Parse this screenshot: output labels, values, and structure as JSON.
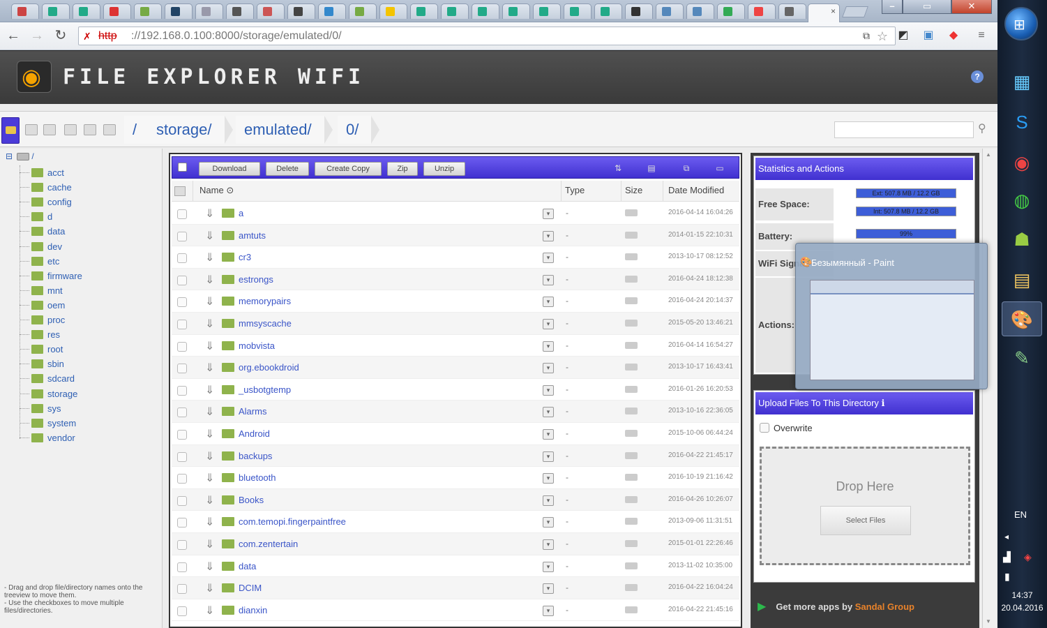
{
  "browser": {
    "url_scheme": "http",
    "url_rest": "://192.168.0.100:8000/storage/emulated/0/",
    "tab_close": "×"
  },
  "app": {
    "title": "FILE EXPLORER WIFI",
    "help": "?"
  },
  "breadcrumbs": [
    "/",
    "storage/",
    "emulated/",
    "0/"
  ],
  "tree": {
    "root": "/",
    "items": [
      "acct",
      "cache",
      "config",
      "d",
      "data",
      "dev",
      "etc",
      "firmware",
      "mnt",
      "oem",
      "proc",
      "res",
      "root",
      "sbin",
      "sdcard",
      "storage",
      "sys",
      "system",
      "vendor"
    ],
    "hint": "- Drag and drop file/directory names onto the treeview to move them.\n- Use the checkboxes to move multiple files/directories."
  },
  "toolbar": {
    "download": "Download",
    "delete": "Delete",
    "create_copy": "Create Copy",
    "zip": "Zip",
    "unzip": "Unzip"
  },
  "columns": {
    "name": "Name",
    "type": "Type",
    "size": "Size",
    "date": "Date Modified"
  },
  "files": [
    {
      "name": "a",
      "type": "-",
      "date": "2016-04-14 16:04:26"
    },
    {
      "name": "amtuts",
      "type": "-",
      "date": "2014-01-15 22:10:31"
    },
    {
      "name": "cr3",
      "type": "-",
      "date": "2013-10-17 08:12:52"
    },
    {
      "name": "estrongs",
      "type": "-",
      "date": "2016-04-24 18:12:38"
    },
    {
      "name": "memorypairs",
      "type": "-",
      "date": "2016-04-24 20:14:37"
    },
    {
      "name": "mmsyscache",
      "type": "-",
      "date": "2015-05-20 13:46:21"
    },
    {
      "name": "mobvista",
      "type": "-",
      "date": "2016-04-14 16:54:27"
    },
    {
      "name": "org.ebookdroid",
      "type": "-",
      "date": "2013-10-17 16:43:41"
    },
    {
      "name": "_usbotgtemp",
      "type": "-",
      "date": "2016-01-26 16:20:53"
    },
    {
      "name": "Alarms",
      "type": "-",
      "date": "2013-10-16 22:36:05"
    },
    {
      "name": "Android",
      "type": "-",
      "date": "2015-10-06 06:44:24"
    },
    {
      "name": "backups",
      "type": "-",
      "date": "2016-04-22 21:45:17"
    },
    {
      "name": "bluetooth",
      "type": "-",
      "date": "2016-10-19 21:16:42"
    },
    {
      "name": "Books",
      "type": "-",
      "date": "2016-04-26 10:26:07"
    },
    {
      "name": "com.temopi.fingerpaintfree",
      "type": "-",
      "date": "2013-09-06 11:31:51"
    },
    {
      "name": "com.zentertain",
      "type": "-",
      "date": "2015-01-01 22:26:46"
    },
    {
      "name": "data",
      "type": "-",
      "date": "2013-11-02 10:35:00"
    },
    {
      "name": "DCIM",
      "type": "-",
      "date": "2016-04-22 16:04:24"
    },
    {
      "name": "dianxin",
      "type": "-",
      "date": "2016-04-22 21:45:16"
    }
  ],
  "stats": {
    "header": "Statistics and Actions",
    "free_space_label": "Free Space:",
    "ext_space": "Ext: 507.8 MB / 12.2 GB",
    "int_space": "Int: 507.8 MB / 12.2 GB",
    "battery_label": "Battery:",
    "battery_value": "99%",
    "wifi_label": "WiFi Signal:",
    "actions_label": "Actions:"
  },
  "upload": {
    "header": "Upload Files To This Directory",
    "overwrite": "Overwrite",
    "drop_here": "Drop Here",
    "select_files": "Select Files"
  },
  "footer": {
    "more_apps": "Get more apps by",
    "brand": "Sandal Group"
  },
  "thumbnail": {
    "title": "Безымянный - Paint"
  },
  "taskbar": {
    "lang": "EN",
    "time": "14:37",
    "date": "20.04.2016"
  }
}
